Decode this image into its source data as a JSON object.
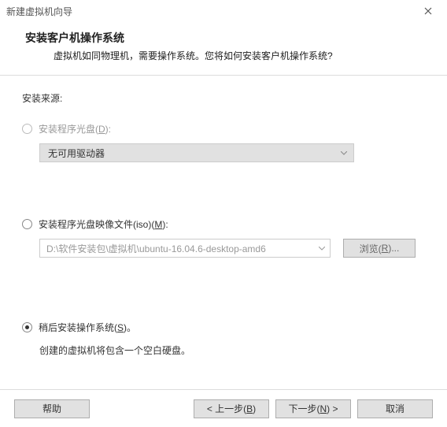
{
  "window": {
    "title": "新建虚拟机向导"
  },
  "header": {
    "title": "安装客户机操作系统",
    "desc": "虚拟机如同物理机，需要操作系统。您将如何安装客户机操作系统?"
  },
  "source": {
    "label": "安装来源:"
  },
  "option_disc": {
    "label_prefix": "安装程序光盘(",
    "accel": "D",
    "label_suffix": "):",
    "dropdown": "无可用驱动器"
  },
  "option_iso": {
    "label_prefix": "安装程序光盘映像文件(iso)(",
    "accel": "M",
    "label_suffix": "):",
    "path": "D:\\软件安装包\\虚拟机\\ubuntu-16.04.6-desktop-amd6",
    "browse_prefix": "浏览(",
    "browse_accel": "R",
    "browse_suffix": ")..."
  },
  "option_later": {
    "label_prefix": "稍后安装操作系统(",
    "accel": "S",
    "label_suffix": ")。",
    "desc": "创建的虚拟机将包含一个空白硬盘。"
  },
  "footer": {
    "help": "帮助",
    "back_prefix": "< 上一步(",
    "back_accel": "B",
    "back_suffix": ")",
    "next_prefix": "下一步(",
    "next_accel": "N",
    "next_suffix": ") >",
    "cancel": "取消"
  }
}
